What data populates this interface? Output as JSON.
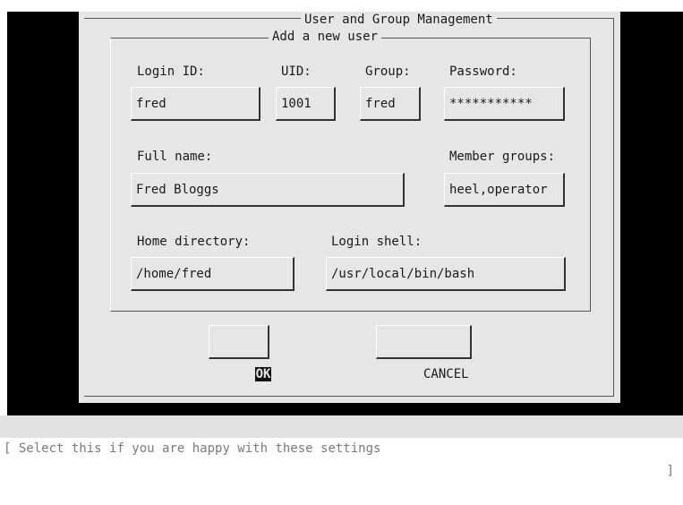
{
  "dialog": {
    "title": "User and Group Management",
    "section_title": "Add a new user"
  },
  "form": {
    "login_id_label": "Login ID:",
    "login_id_value": "fred",
    "uid_label": "UID:",
    "uid_value": "1001",
    "group_label": "Group:",
    "group_value": "fred",
    "password_label": "Password:",
    "password_value": "***********",
    "full_name_label": "Full name:",
    "full_name_value": "Fred Bloggs",
    "member_groups_label": "Member groups:",
    "member_groups_value": "heel,operator",
    "home_directory_label": "Home directory:",
    "home_directory_value": "/home/fred",
    "login_shell_label": "Login shell:",
    "login_shell_value": "/usr/local/bin/bash"
  },
  "buttons": {
    "ok_label": "OK",
    "cancel_label": "CANCEL"
  },
  "statusbar": {
    "left_bracket": "[",
    "message": "Select this if you are happy with these settings",
    "right_bracket": "]"
  },
  "colors": {
    "dialog_bg": "#e6e6e6",
    "backdrop": "#000000",
    "status_text": "#7a7a7a"
  }
}
